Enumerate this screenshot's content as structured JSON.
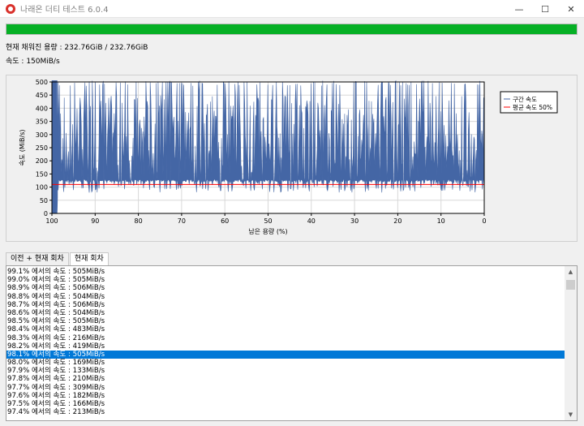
{
  "window": {
    "title": "나래온 더티 테스트 6.0.4",
    "minimize_icon": "minimize-icon",
    "maximize_icon": "maximize-icon",
    "close_icon": "close-icon"
  },
  "progress": {
    "fraction": 1.0,
    "color": "#06b025"
  },
  "info": {
    "written": "현재 채워진 용량 : 232.76GiB / 232.76GiB",
    "speed": "속도 : 150MiB/s"
  },
  "chart_data": {
    "type": "line",
    "xlabel": "남은 용량 (%)",
    "ylabel": "속도 (MiB/s)",
    "xlim": [
      100,
      0
    ],
    "ylim": [
      0,
      500
    ],
    "x_ticks": [
      100,
      90,
      80,
      70,
      60,
      50,
      40,
      30,
      20,
      10,
      0
    ],
    "y_ticks": [
      0,
      50,
      100,
      150,
      200,
      250,
      300,
      350,
      400,
      450,
      500
    ],
    "grid": true,
    "legend_position": "right",
    "series": [
      {
        "name": "구간 속도",
        "color": "#4466a5",
        "description_range": [
          80,
          505
        ],
        "initial_value": 505
      },
      {
        "name": "평균 속도 50%",
        "color": "#ff0000",
        "values": [
          110
        ]
      }
    ]
  },
  "tabs": [
    {
      "label": "이전 + 현재 회차",
      "active": false
    },
    {
      "label": "현재 회차",
      "active": true
    }
  ],
  "log": [
    {
      "text": "99.1% 에서의 속도 : 505MiB/s",
      "selected": false
    },
    {
      "text": "99.0% 에서의 속도 : 505MiB/s",
      "selected": false
    },
    {
      "text": "98.9% 에서의 속도 : 506MiB/s",
      "selected": false
    },
    {
      "text": "98.8% 에서의 속도 : 504MiB/s",
      "selected": false
    },
    {
      "text": "98.7% 에서의 속도 : 506MiB/s",
      "selected": false
    },
    {
      "text": "98.6% 에서의 속도 : 504MiB/s",
      "selected": false
    },
    {
      "text": "98.5% 에서의 속도 : 505MiB/s",
      "selected": false
    },
    {
      "text": "98.4% 에서의 속도 : 483MiB/s",
      "selected": false
    },
    {
      "text": "98.3% 에서의 속도 : 216MiB/s",
      "selected": false
    },
    {
      "text": "98.2% 에서의 속도 : 419MiB/s",
      "selected": false
    },
    {
      "text": "98.1% 에서의 속도 : 505MiB/s",
      "selected": true
    },
    {
      "text": "98.0% 에서의 속도 : 169MiB/s",
      "selected": false
    },
    {
      "text": "97.9% 에서의 속도 : 133MiB/s",
      "selected": false
    },
    {
      "text": "97.8% 에서의 속도 : 210MiB/s",
      "selected": false
    },
    {
      "text": "97.7% 에서의 속도 : 309MiB/s",
      "selected": false
    },
    {
      "text": "97.6% 에서의 속도 : 182MiB/s",
      "selected": false
    },
    {
      "text": "97.5% 에서의 속도 : 166MiB/s",
      "selected": false
    },
    {
      "text": "97.4% 에서의 속도 : 213MiB/s",
      "selected": false
    }
  ],
  "colors": {
    "selection": "#0078d7",
    "plot_fill": "#4466a5",
    "average_line": "#ff0000"
  }
}
